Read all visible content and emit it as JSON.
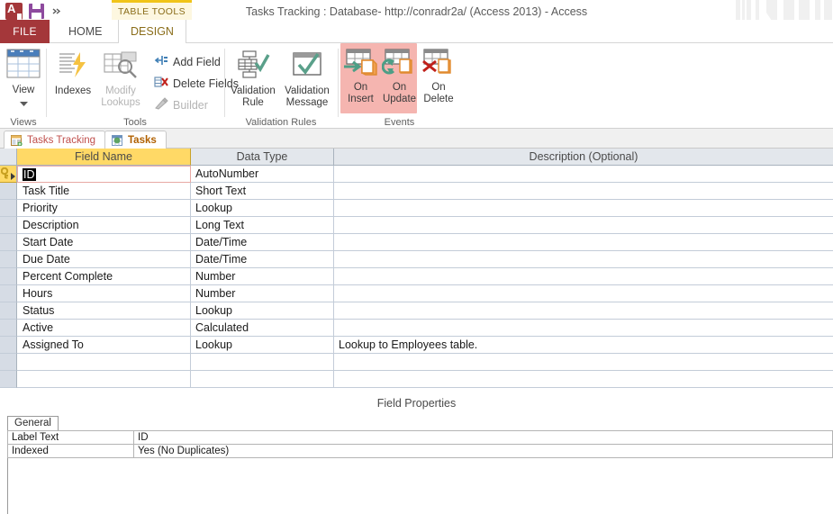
{
  "window": {
    "title": "Tasks Tracking : Database- http://conradr2a/ (Access 2013) - Access",
    "quick_access": [
      {
        "name": "access-logo",
        "label": "Access"
      },
      {
        "name": "save-icon",
        "label": "Save"
      },
      {
        "name": "customize-qat-icon",
        "label": "Customize Quick Access Toolbar"
      }
    ]
  },
  "contextual": {
    "label": "TABLE TOOLS"
  },
  "ribbon_tabs": {
    "file": "FILE",
    "home": "HOME",
    "design": "DESIGN"
  },
  "ribbon": {
    "groups": [
      {
        "name": "views",
        "label": "Views",
        "buttons": [
          {
            "label_line1": "View",
            "label_line2": "",
            "icon": "datasheet-view-icon",
            "dropdown": true
          }
        ]
      },
      {
        "name": "tools",
        "label": "Tools",
        "buttons": [
          {
            "label_line1": "Indexes",
            "label_line2": "",
            "icon": "indexes-icon",
            "disabled": false
          },
          {
            "label_line1": "Modify",
            "label_line2": "Lookups",
            "icon": "modify-lookups-icon",
            "disabled": true
          }
        ],
        "small_buttons": [
          {
            "label": "Add Field",
            "icon": "add-field-icon",
            "disabled": false
          },
          {
            "label": "Delete Fields",
            "icon": "delete-fields-icon",
            "disabled": false
          },
          {
            "label": "Builder",
            "icon": "builder-icon",
            "disabled": true
          }
        ]
      },
      {
        "name": "validation-rules",
        "label": "Validation Rules",
        "buttons": [
          {
            "label_line1": "Validation",
            "label_line2": "Rule",
            "icon": "validation-rule-icon"
          },
          {
            "label_line1": "Validation",
            "label_line2": "Message",
            "icon": "validation-message-icon"
          }
        ]
      },
      {
        "name": "events",
        "label": "Events",
        "highlighted": true,
        "buttons": [
          {
            "label_line1": "On",
            "label_line2": "Insert",
            "icon": "on-insert-icon",
            "highlighted": true
          },
          {
            "label_line1": "On",
            "label_line2": "Update",
            "icon": "on-update-icon",
            "highlighted": true
          },
          {
            "label_line1": "On",
            "label_line2": "Delete",
            "icon": "on-delete-icon",
            "highlighted": false
          }
        ]
      }
    ]
  },
  "document_tabs": [
    {
      "label": "Tasks Tracking",
      "icon": "navigation-form-icon",
      "active": false
    },
    {
      "label": "Tasks",
      "icon": "table-icon",
      "active": true
    }
  ],
  "field_grid": {
    "headers": {
      "field_name": "Field Name",
      "data_type": "Data Type",
      "description": "Description (Optional)"
    },
    "rows": [
      {
        "field_name": "ID",
        "data_type": "AutoNumber",
        "description": "",
        "primary_key": true,
        "editing": true
      },
      {
        "field_name": "Task Title",
        "data_type": "Short Text",
        "description": ""
      },
      {
        "field_name": "Priority",
        "data_type": "Lookup",
        "description": ""
      },
      {
        "field_name": "Description",
        "data_type": "Long Text",
        "description": ""
      },
      {
        "field_name": "Start Date",
        "data_type": "Date/Time",
        "description": ""
      },
      {
        "field_name": "Due Date",
        "data_type": "Date/Time",
        "description": ""
      },
      {
        "field_name": "Percent Complete",
        "data_type": "Number",
        "description": ""
      },
      {
        "field_name": "Hours",
        "data_type": "Number",
        "description": ""
      },
      {
        "field_name": "Status",
        "data_type": "Lookup",
        "description": ""
      },
      {
        "field_name": "Active",
        "data_type": "Calculated",
        "description": ""
      },
      {
        "field_name": "Assigned To",
        "data_type": "Lookup",
        "description": "Lookup to Employees table."
      },
      {
        "field_name": "",
        "data_type": "",
        "description": ""
      },
      {
        "field_name": "",
        "data_type": "",
        "description": ""
      }
    ]
  },
  "field_properties": {
    "band_label": "Field Properties",
    "tabs": [
      {
        "label": "General",
        "active": true
      }
    ],
    "properties": [
      {
        "key": "Label Text",
        "value": "ID"
      },
      {
        "key": "Indexed",
        "value": "Yes (No Duplicates)"
      }
    ]
  },
  "colors": {
    "accent_red": "#a4373a",
    "contextual_gold": "#f0c419",
    "highlight_pink": "#f5b5b0",
    "header_yellow": "#ffd966",
    "header_grey": "#e3e7ec"
  }
}
